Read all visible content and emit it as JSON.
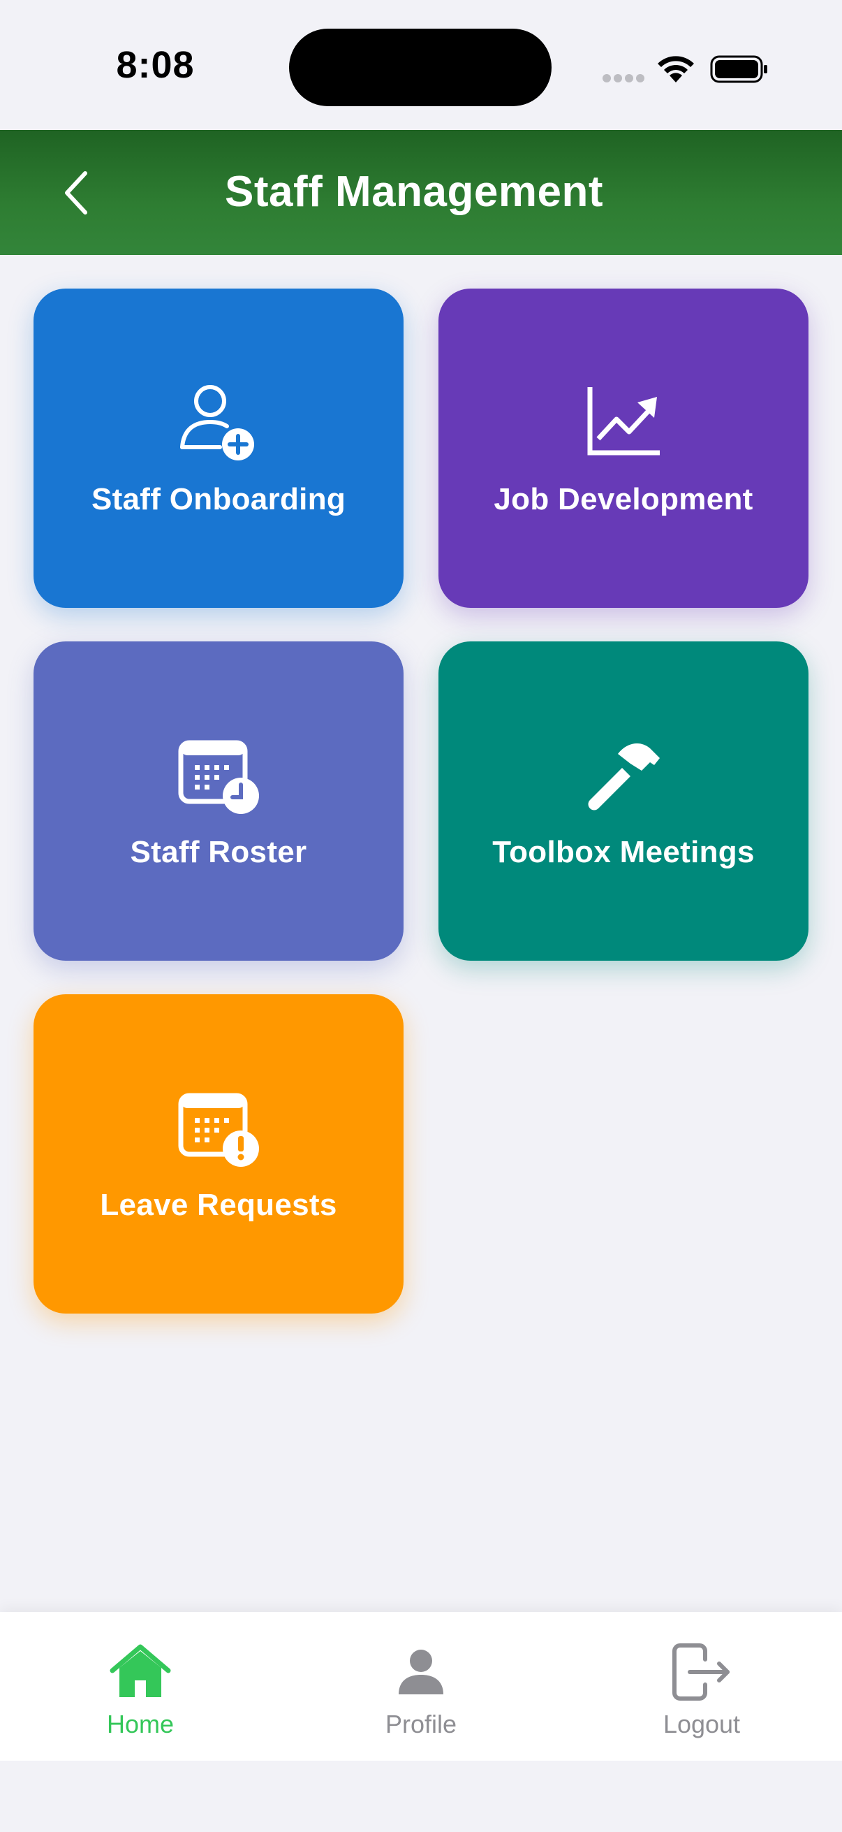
{
  "status_bar": {
    "time": "8:08"
  },
  "header": {
    "title": "Staff Management",
    "back_icon": "chevron-left-icon",
    "gradient": [
      "#1f6323",
      "#33853a"
    ]
  },
  "tiles": [
    {
      "label": "Staff Onboarding",
      "icon": "user-add-icon",
      "color": "#1976d2"
    },
    {
      "label": "Job Development",
      "icon": "chart-line-icon",
      "color": "#673ab7"
    },
    {
      "label": "Staff Roster",
      "icon": "calendar-clock-icon",
      "color": "#5c6bc0"
    },
    {
      "label": "Toolbox Meetings",
      "icon": "hammer-icon",
      "color": "#00897b"
    },
    {
      "label": "Leave Requests",
      "icon": "calendar-alert-icon",
      "color": "#ff9800"
    }
  ],
  "tab_bar": {
    "active_color": "#34c759",
    "inactive_color": "#8e8e93",
    "items": [
      {
        "label": "Home",
        "icon": "home-icon",
        "active": true
      },
      {
        "label": "Profile",
        "icon": "person-icon",
        "active": false
      },
      {
        "label": "Logout",
        "icon": "logout-icon",
        "active": false
      }
    ]
  }
}
